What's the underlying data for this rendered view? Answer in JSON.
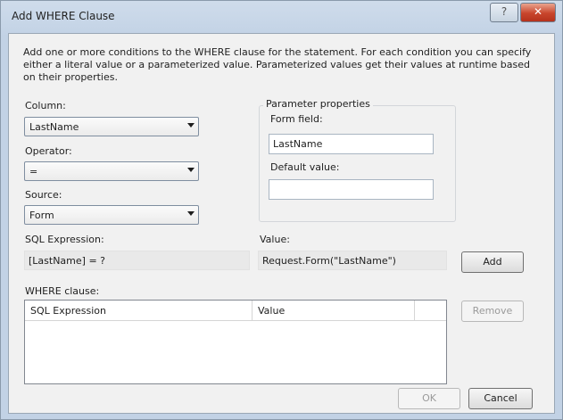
{
  "window": {
    "title": "Add WHERE Clause",
    "help_glyph": "?",
    "close_glyph": "✕"
  },
  "description": "Add one or more conditions to the WHERE clause for the statement. For each condition you can specify either a literal value or a parameterized value. Parameterized values get their values at runtime based on their properties.",
  "column": {
    "label": "Column:",
    "value": "LastName"
  },
  "operator": {
    "label": "Operator:",
    "value": "="
  },
  "source": {
    "label": "Source:",
    "value": "Form"
  },
  "parameter_properties": {
    "title": "Parameter properties",
    "form_field_label": "Form field:",
    "form_field_value": "LastName",
    "default_value_label": "Default value:",
    "default_value": ""
  },
  "sql_expression": {
    "label": "SQL Expression:",
    "value": "[LastName] = ?"
  },
  "value": {
    "label": "Value:",
    "value": "Request.Form(\"LastName\")"
  },
  "where_clause": {
    "label": "WHERE clause:",
    "columns": [
      "SQL Expression",
      "Value"
    ],
    "rows": []
  },
  "buttons": {
    "add": "Add",
    "remove": "Remove",
    "ok": "OK",
    "cancel": "Cancel"
  },
  "icons": {
    "dropdown": "chevron-down-icon",
    "help": "help-icon",
    "close": "close-icon"
  }
}
